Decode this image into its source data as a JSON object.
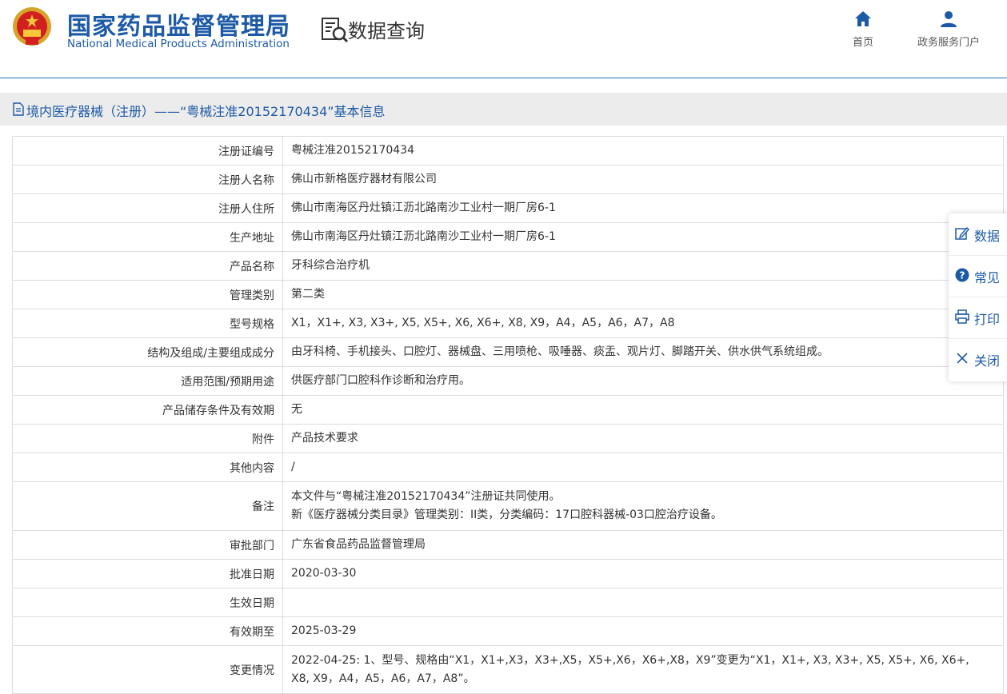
{
  "header": {
    "org_cn": "国家药品监督管理局",
    "org_en": "National Medical Products Administration",
    "query_title": "数据查询",
    "nav_home": "首页",
    "nav_portal": "政务服务门户"
  },
  "breadcrumb": {
    "text": "境内医疗器械（注册）——“粤械注准20152170434”基本信息"
  },
  "record": {
    "rows": [
      {
        "label": "注册证编号",
        "value": "粤械注准20152170434"
      },
      {
        "label": "注册人名称",
        "value": "佛山市新格医疗器材有限公司"
      },
      {
        "label": "注册人住所",
        "value": "佛山市南海区丹灶镇江沥北路南沙工业村一期厂房6-1"
      },
      {
        "label": "生产地址",
        "value": "佛山市南海区丹灶镇江沥北路南沙工业村一期厂房6-1"
      },
      {
        "label": "产品名称",
        "value": "牙科综合治疗机"
      },
      {
        "label": "管理类别",
        "value": "第二类"
      },
      {
        "label": "型号规格",
        "value": "X1，X1+, X3, X3+, X5, X5+, X6, X6+, X8, X9，A4，A5，A6，A7，A8"
      },
      {
        "label": "结构及组成/主要组成成分",
        "value": "由牙科椅、手机接头、口腔灯、器械盘、三用喷枪、吸唾器、痰盂、观片灯、脚踏开关、供水供气系统组成。"
      },
      {
        "label": "适用范围/预期用途",
        "value": "供医疗部门口腔科作诊断和治疗用。"
      },
      {
        "label": "产品储存条件及有效期",
        "value": "无"
      },
      {
        "label": "附件",
        "value": "产品技术要求"
      },
      {
        "label": "其他内容",
        "value": "/"
      },
      {
        "label": "备注",
        "value_line1": "本文件与“粤械注准20152170434”注册证共同使用。",
        "value_line2": "新《医疗器械分类目录》管理类别：II类，分类编码：17口腔科器械-03口腔治疗设备。"
      },
      {
        "label": "审批部门",
        "value": "广东省食品药品监督管理局"
      },
      {
        "label": "批准日期",
        "value": "2020-03-30"
      },
      {
        "label": "生效日期",
        "value": ""
      },
      {
        "label": "有效期至",
        "value": "2025-03-29"
      },
      {
        "label": "变更情况",
        "value_line1": "2022-04-25: 1、型号、规格由“X1，X1+,X3，X3+,X5，X5+,X6，X6+,X8，X9”变更为“X1，X1+, X3, X3+, X5, X5+, X6, X6+,",
        "value_line2": "X8, X9，A4，A5，A6，A7，A8”。"
      }
    ]
  },
  "side_panel": {
    "items": [
      "数据",
      "常见",
      "打印",
      "关闭"
    ]
  },
  "colors": {
    "brand_blue": "#1c5aa6",
    "breadcrumb_bg": "#ececec",
    "table_border": "#dcdcdc"
  },
  "icons": [
    "national-emblem-icon",
    "data-query-icon",
    "home-icon",
    "user-icon",
    "document-icon",
    "edit-icon",
    "question-icon",
    "print-icon",
    "close-icon"
  ]
}
